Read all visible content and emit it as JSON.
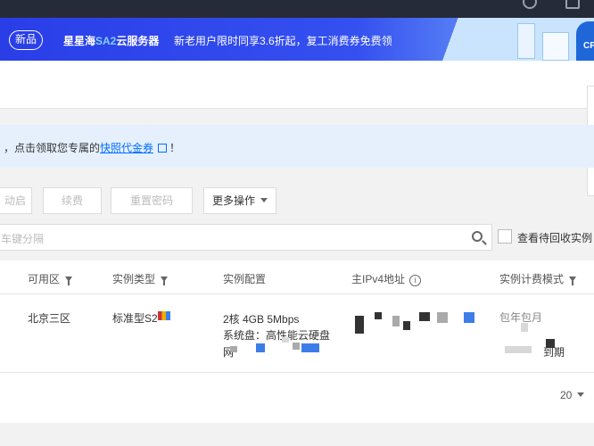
{
  "banner": {
    "badge": "新品",
    "title_prefix": "星星海",
    "title_accent": "SA2",
    "title_suffix": "云服务器",
    "promo": "新老用户限时同享3.6折起，复工消费券免费领",
    "deco_text": "CP"
  },
  "notice": {
    "text_before": "，点击领取您专属的",
    "link": "快照代金券",
    "text_after": "！"
  },
  "toolbar": {
    "start_label": "动启",
    "renew_label": "续费",
    "reset_password_label": "重置密码",
    "more_label": "更多操作"
  },
  "search": {
    "placeholder": "车键分隔"
  },
  "recycle_checkbox": {
    "label": "查看待回收实例"
  },
  "table": {
    "columns": {
      "zone": "可用区",
      "instance_type": "实例类型",
      "config": "实例配置",
      "ipv4": "主IPv4地址",
      "billing": "实例计费模式"
    },
    "rows": [
      {
        "zone": "北京三区",
        "instance_type": "标准型S2",
        "config_line1": "2核 4GB 5Mbps",
        "config_line2": "系统盘：高性能云硬盘",
        "config_line3": "网",
        "billing_line1": "包年包月",
        "billing_line2": "到期"
      }
    ]
  },
  "pagination": {
    "page_size": "20"
  },
  "colors": {
    "topbar": "#262b3a",
    "banner": "#3450f0",
    "notice_bg": "#e6f0fd",
    "link": "#006eff",
    "accent": "#e8523c"
  }
}
